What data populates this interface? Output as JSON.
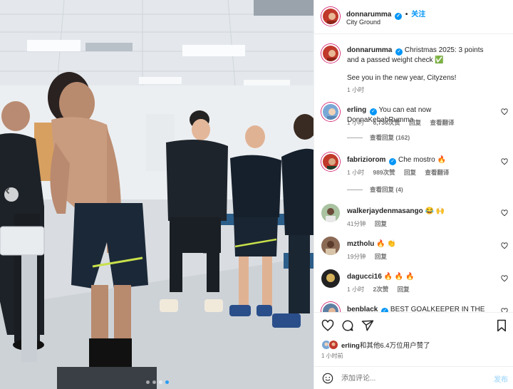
{
  "post": {
    "username": "donnarumma",
    "follow_label": "关注",
    "dot": "•",
    "location": "City Ground"
  },
  "caption": {
    "username": "donnarumma",
    "text": "Christmas 2025: 3 points and a passed weight check ✅",
    "text2": "See you in the new year, Cityzens!",
    "time": "1 小时"
  },
  "comments": [
    {
      "username": "erling",
      "verified": true,
      "text": "You can eat now DonnaKebabRumma",
      "time": "1 小时",
      "likes": "6,736次赞",
      "reply": "回复",
      "translate": "查看翻译",
      "replies_label": "查看回复 (162)",
      "avatar_color": "#7aa8d6"
    },
    {
      "username": "fabriziorom",
      "verified": true,
      "text": "Che mostro 🔥",
      "time": "1 小时",
      "likes": "989次赞",
      "reply": "回复",
      "translate": "查看翻译",
      "replies_label": "查看回复 (4)",
      "avatar_color": "#c0392b"
    },
    {
      "username": "walkerjaydenmasango",
      "verified": false,
      "text": "😂 🙌",
      "time": "41分钟",
      "likes": "",
      "reply": "回复",
      "translate": "",
      "replies_label": "",
      "avatar_color": "#a9c2a0"
    },
    {
      "username": "mztholu",
      "verified": false,
      "text": "🔥 👏",
      "time": "19分钟",
      "likes": "",
      "reply": "回复",
      "translate": "",
      "replies_label": "",
      "avatar_color": "#8b6a55"
    },
    {
      "username": "dagucci16",
      "verified": false,
      "text": "🔥 🔥 🔥",
      "time": "1 小时",
      "likes": "2次赞",
      "reply": "回复",
      "translate": "",
      "replies_label": "",
      "avatar_color": "#222222"
    },
    {
      "username": "benblack",
      "verified": true,
      "text": "BEST GOALKEEPER IN THE WORLD",
      "time": "",
      "likes": "",
      "reply": "",
      "translate": "",
      "replies_label": "",
      "avatar_color": "#5d7fa3"
    }
  ],
  "likes": {
    "text_user": "erling",
    "text_rest": "和其他6.4万位用户赞了",
    "time": "1 小时前"
  },
  "compose": {
    "placeholder": "添加评论...",
    "post_label": "发布"
  },
  "colors": {
    "accent": "#0095f6",
    "carousel_dot_active": "#2b9cf2"
  },
  "icons": [
    "heart-icon",
    "comment-icon",
    "share-icon",
    "bookmark-icon",
    "emoji-icon",
    "verified-icon",
    "chevron-left-icon"
  ]
}
